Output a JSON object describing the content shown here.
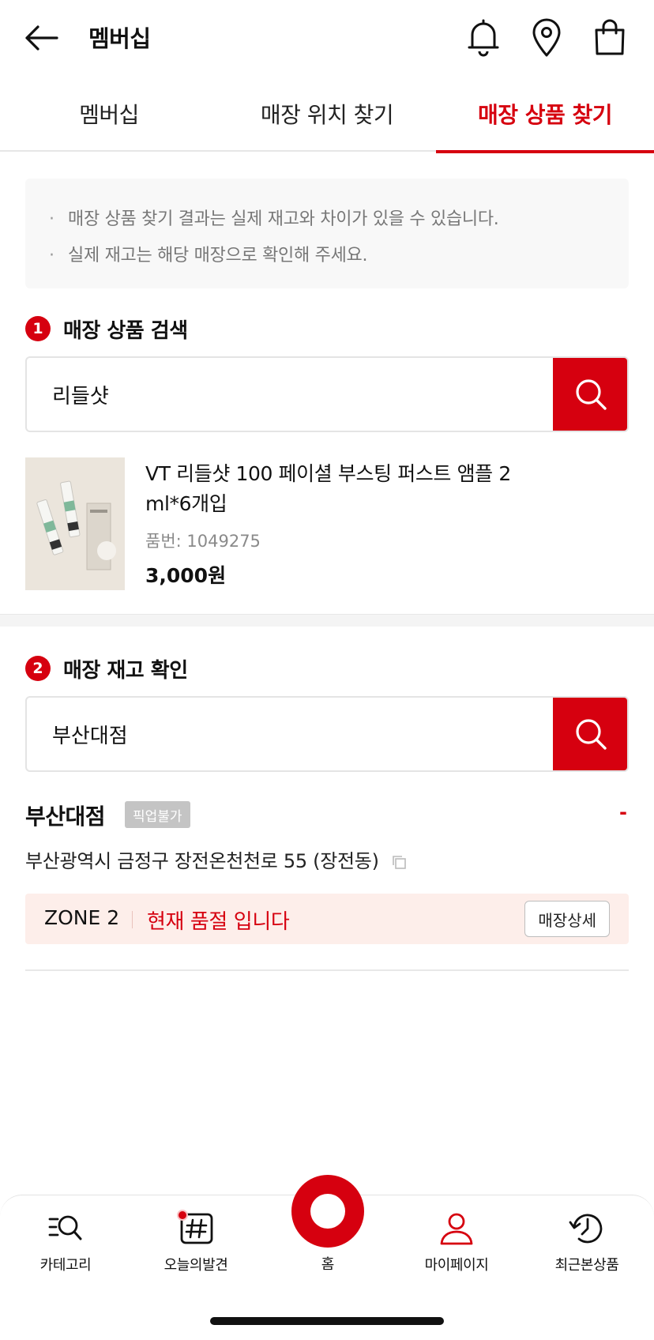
{
  "header": {
    "title": "멤버십"
  },
  "tabs": [
    {
      "label": "멤버십",
      "active": false
    },
    {
      "label": "매장 위치 찾기",
      "active": false
    },
    {
      "label": "매장 상품 찾기",
      "active": true
    }
  ],
  "notice": {
    "lines": [
      "매장 상품 찾기 결과는 실제 재고와 차이가 있을 수 있습니다.",
      "실제 재고는 해당 매장으로 확인해 주세요."
    ],
    "bullet": "·"
  },
  "section1": {
    "number": "1",
    "title": "매장 상품 검색",
    "search_value": "리들샷"
  },
  "product": {
    "name": "VT 리들샷 100 페이셜 부스팅 퍼스트 앰플 2 ml*6개입",
    "code": "품번: 1049275",
    "price": "3,000원"
  },
  "section2": {
    "number": "2",
    "title": "매장 재고 확인",
    "search_value": "부산대점"
  },
  "store": {
    "name": "부산대점",
    "badge": "픽업불가",
    "dash": "-",
    "address": "부산광역시 금정구 장전온천천로 55 (장전동)",
    "zone": "ZONE 2",
    "stock_status": "현재 품절 입니다",
    "detail_button": "매장상세"
  },
  "bottom_nav": {
    "category": "카테고리",
    "discover": "오늘의발견",
    "home": "홈",
    "mypage": "마이페이지",
    "recent": "최근본상품"
  },
  "colors": {
    "accent": "#d6000f",
    "zone_bg": "#fdeeea",
    "badge_bg": "#c4c4c4"
  },
  "icons": [
    "back-arrow-icon",
    "bell-icon",
    "location-pin-icon",
    "shopping-bag-icon",
    "search-icon",
    "copy-icon",
    "category-search-icon",
    "hashtag-icon",
    "home-circle-icon",
    "person-icon",
    "recent-history-icon"
  ]
}
